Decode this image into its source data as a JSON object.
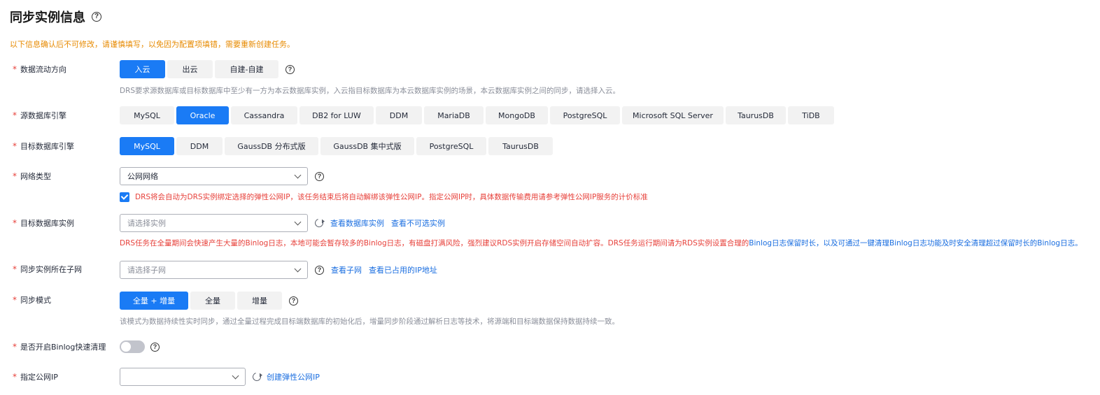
{
  "page": {
    "title": "同步实例信息",
    "warning": "以下信息确认后不可修改，请谨慎填写，以免因为配置项填错，需要重新创建任务。"
  },
  "flow_direction": {
    "label": "数据流动方向",
    "options": [
      "入云",
      "出云",
      "自建-自建"
    ],
    "selected": "入云",
    "hint": "DRS要求源数据库或目标数据库中至少有一方为本云数据库实例，入云指目标数据库为本云数据库实例的场景，本云数据库实例之间的同步，请选择入云。"
  },
  "source_engine": {
    "label": "源数据库引擎",
    "options": [
      "MySQL",
      "Oracle",
      "Cassandra",
      "DB2 for LUW",
      "DDM",
      "MariaDB",
      "MongoDB",
      "PostgreSQL",
      "Microsoft SQL Server",
      "TaurusDB",
      "TiDB"
    ],
    "selected": "Oracle"
  },
  "target_engine": {
    "label": "目标数据库引擎",
    "options": [
      "MySQL",
      "DDM",
      "GaussDB 分布式版",
      "GaussDB 集中式版",
      "PostgreSQL",
      "TaurusDB"
    ],
    "selected": "MySQL"
  },
  "network_type": {
    "label": "网络类型",
    "value": "公网网络",
    "checkbox_text": "DRS将会自动为DRS实例绑定选择的弹性公网IP，该任务结束后将自动解绑该弹性公网IP。指定公网IP时，具体数据传输费用请参考弹性公网IP服务的计价标准",
    "checked": true
  },
  "target_instance": {
    "label": "目标数据库实例",
    "placeholder": "请选择实例",
    "link1": "查看数据库实例",
    "link2": "查看不可选实例",
    "warning_red": "DRS任务在全量期间会快速产生大量的Binlog日志，本地可能会暂存较多的Binlog日志，有磁盘打满风险，强烈建议RDS实例开启存储空间自动扩容。DRS任务运行期间请为RDS实例设置合理的",
    "warning_blue": "Binlog日志保留时长，以及可通过一键清理Binlog日志功能及时安全清理超过保留时长的Binlog日志。"
  },
  "subnet": {
    "label": "同步实例所在子网",
    "placeholder": "请选择子网",
    "link1": "查看子网",
    "link2": "查看已占用的IP地址"
  },
  "sync_mode": {
    "label": "同步模式",
    "options": [
      "全量 + 增量",
      "全量",
      "增量"
    ],
    "selected": "全量 + 增量",
    "hint": "该模式为数据持续性实时同步，通过全量过程完成目标端数据库的初始化后，增量同步阶段通过解析日志等技术，将源端和目标端数据保持数据持续一致。"
  },
  "binlog_cleanup": {
    "label": "是否开启Binlog快速清理",
    "enabled": false
  },
  "public_ip": {
    "label": "指定公网IP",
    "value": "",
    "link": "创建弹性公网IP"
  },
  "colors": {
    "primary": "#1a7bf5",
    "warning": "#e78a00",
    "danger": "#e7403a",
    "link": "#1a6ee0"
  }
}
